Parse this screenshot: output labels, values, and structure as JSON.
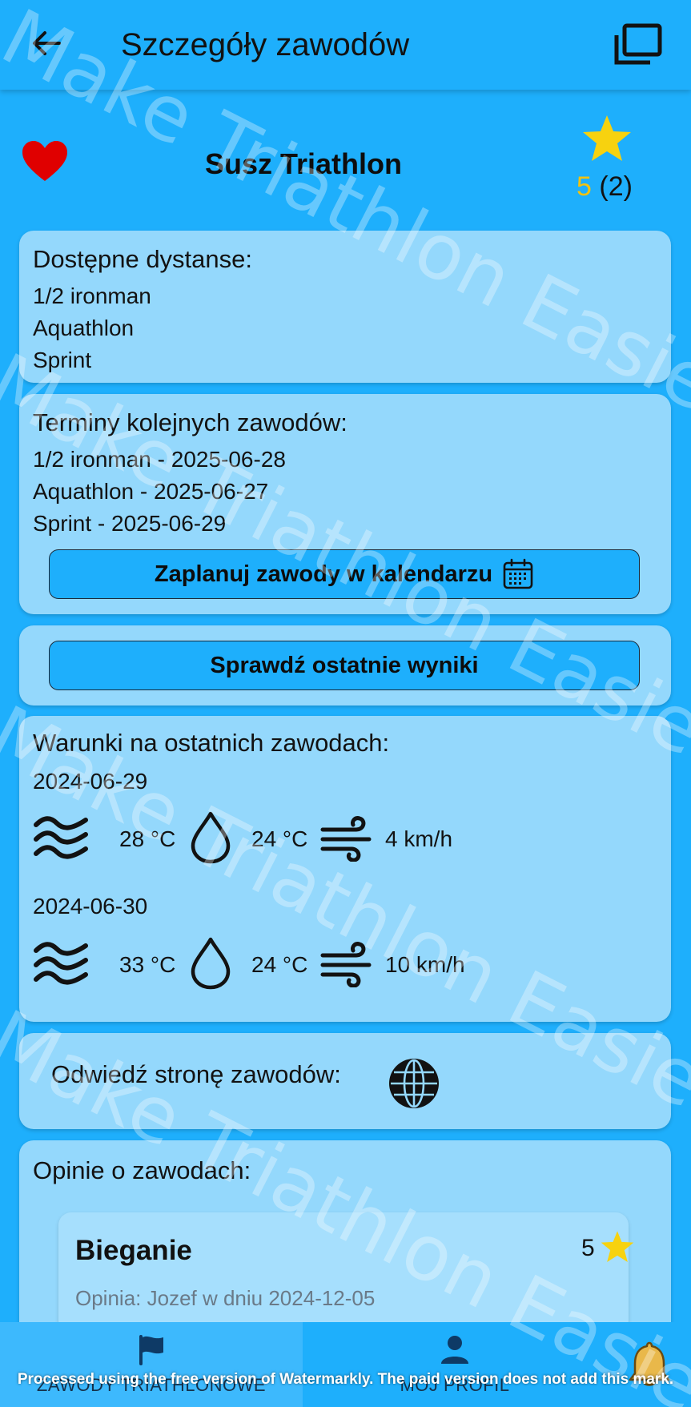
{
  "appbar": {
    "title": "Szczegóły zawodów",
    "back_icon": "arrow-back-icon",
    "action_icon": "tabs-view-icon"
  },
  "event": {
    "name": "Susz Triathlon",
    "favorite_icon": "heart-icon",
    "favorite_color": "#E00000",
    "rating": "5",
    "rating_count": "(2)",
    "rating_color": "#F3C20E"
  },
  "distances": {
    "heading": "Dostępne dystanse:",
    "items": [
      "1/2 ironman",
      "Aquathlon",
      "Sprint"
    ]
  },
  "schedule": {
    "heading": "Terminy kolejnych zawodów:",
    "items": [
      "1/2 ironman - 2025-06-28",
      "Aquathlon - 2025-06-27",
      "Sprint - 2025-06-29"
    ],
    "calendar_button": "Zaplanuj zawody w kalendarzu",
    "calendar_icon": "calendar-icon"
  },
  "results": {
    "button": "Sprawdź ostatnie wyniki"
  },
  "conditions": {
    "heading": "Warunki na ostatnich zawodach:",
    "days": [
      {
        "date": "2024-06-29",
        "water_temp": "28 °C",
        "air_temp": "24 °C",
        "wind": "4 km/h"
      },
      {
        "date": "2024-06-30",
        "water_temp": "33 °C",
        "air_temp": "24 °C",
        "wind": "10 km/h"
      }
    ],
    "icons": [
      "water-waves-icon",
      "drop-icon",
      "wind-icon"
    ]
  },
  "website": {
    "label": "Odwiedź stronę zawodów:",
    "icon": "globe-icon"
  },
  "reviews": {
    "heading": "Opinie o zawodach:",
    "items": [
      {
        "title": "Bieganie",
        "meta": "Opinia: Jozef w dniu 2024-12-05",
        "score": "5"
      }
    ]
  },
  "bottom_nav": {
    "items": [
      {
        "label": "ZAWODY TRIATHLONOWE",
        "icon": "flag-icon",
        "active": true
      },
      {
        "label": "MÓJ PROFIL",
        "icon": "person-icon",
        "active": false
      }
    ],
    "bell_icon": "bell-icon"
  },
  "overlay": {
    "watermark_text": "Make Triathlon Easier",
    "footer_notice": "Processed using the free version of Watermarkly. The paid version does not add this mark."
  },
  "colors": {
    "background": "#1EAFFC",
    "card": "#94D8FC",
    "review_card": "#A6DFFD"
  }
}
